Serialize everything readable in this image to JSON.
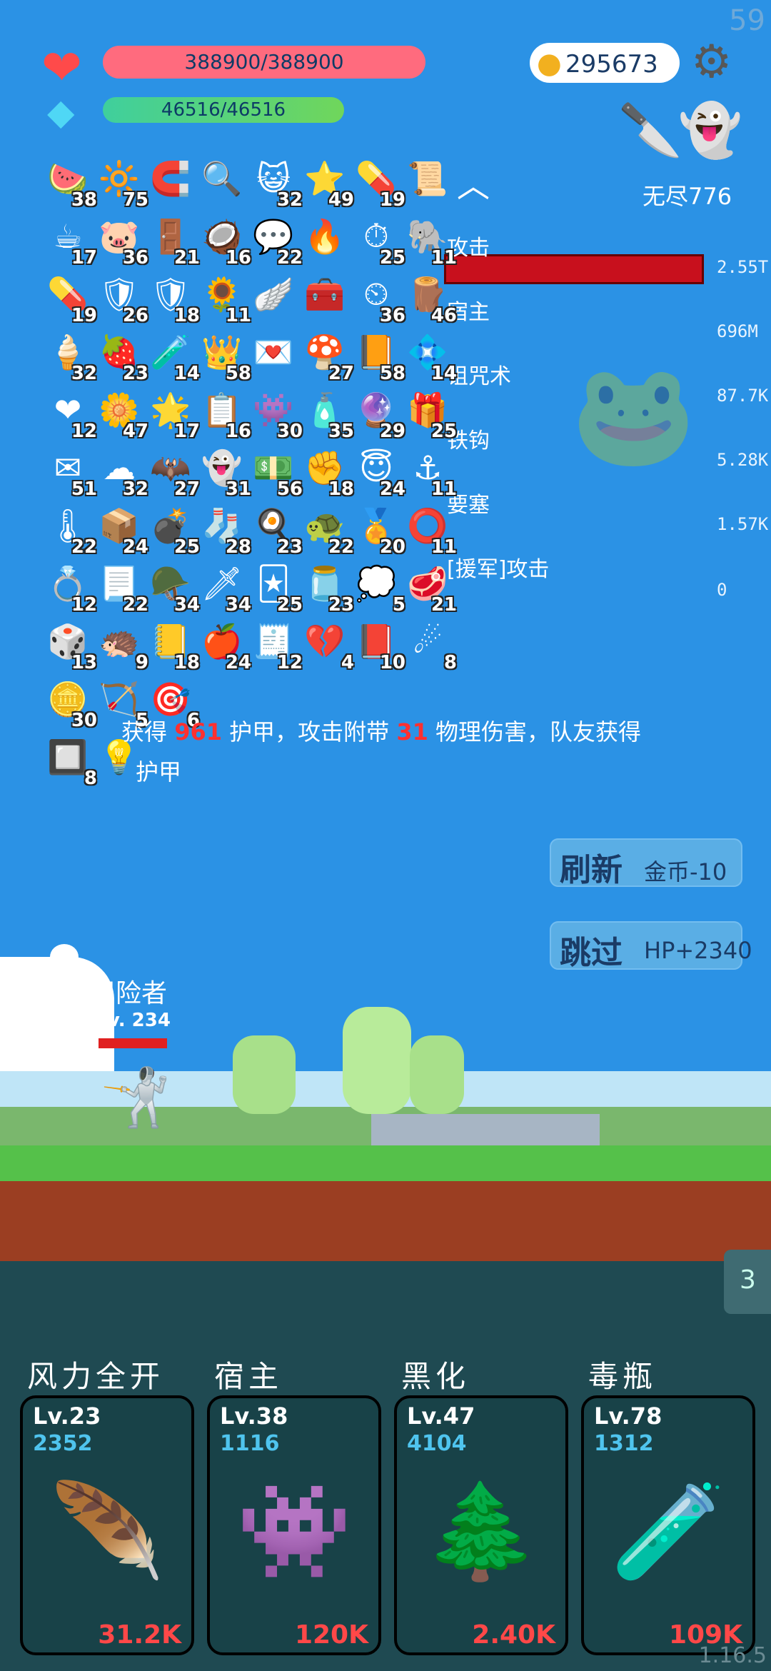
{
  "fps": "59",
  "version": "1.16.5",
  "hp": {
    "text": "388900/388900",
    "fill": 1.0,
    "icon": "heart-icon"
  },
  "mp": {
    "text": "46516/46516",
    "fill": 1.0,
    "icon": "crystal-icon"
  },
  "gold": "295673",
  "mode_label": "无尽776",
  "items": [
    {
      "icon": "🍉",
      "count": "38"
    },
    {
      "icon": "🔆",
      "count": "75"
    },
    {
      "icon": "🧲",
      "count": ""
    },
    {
      "icon": "🔍",
      "count": ""
    },
    {
      "icon": "😺",
      "count": "32"
    },
    {
      "icon": "⭐",
      "count": "49"
    },
    {
      "icon": "💊",
      "count": "19"
    },
    {
      "icon": "📜",
      "count": ""
    },
    {
      "icon": "☕",
      "count": "17"
    },
    {
      "icon": "🐷",
      "count": "36"
    },
    {
      "icon": "🚪",
      "count": "21"
    },
    {
      "icon": "🥥",
      "count": "16"
    },
    {
      "icon": "💬",
      "count": "22"
    },
    {
      "icon": "🔥",
      "count": ""
    },
    {
      "icon": "⏱",
      "count": "25"
    },
    {
      "icon": "🐘",
      "count": "11"
    },
    {
      "icon": "💊",
      "count": "19"
    },
    {
      "icon": "🛡",
      "count": "26"
    },
    {
      "icon": "🛡",
      "count": "18"
    },
    {
      "icon": "🌻",
      "count": "11"
    },
    {
      "icon": "🪽",
      "count": ""
    },
    {
      "icon": "🧰",
      "count": ""
    },
    {
      "icon": "⏲",
      "count": "36"
    },
    {
      "icon": "🪵",
      "count": "46"
    },
    {
      "icon": "🍦",
      "count": "32"
    },
    {
      "icon": "🍓",
      "count": "23"
    },
    {
      "icon": "🧪",
      "count": "14"
    },
    {
      "icon": "👑",
      "count": "58"
    },
    {
      "icon": "💌",
      "count": ""
    },
    {
      "icon": "🍄",
      "count": "27"
    },
    {
      "icon": "📙",
      "count": "58"
    },
    {
      "icon": "💠",
      "count": "14"
    },
    {
      "icon": "❤",
      "count": "12"
    },
    {
      "icon": "🌼",
      "count": "47"
    },
    {
      "icon": "🌟",
      "count": "17"
    },
    {
      "icon": "📋",
      "count": "16"
    },
    {
      "icon": "👾",
      "count": "30"
    },
    {
      "icon": "🧴",
      "count": "35"
    },
    {
      "icon": "🔮",
      "count": "29"
    },
    {
      "icon": "🎁",
      "count": "25"
    },
    {
      "icon": "✉",
      "count": "51"
    },
    {
      "icon": "☁",
      "count": "32"
    },
    {
      "icon": "🦇",
      "count": "27"
    },
    {
      "icon": "👻",
      "count": "31"
    },
    {
      "icon": "💵",
      "count": "56"
    },
    {
      "icon": "✊",
      "count": "18"
    },
    {
      "icon": "😇",
      "count": "24"
    },
    {
      "icon": "⚓",
      "count": "11"
    },
    {
      "icon": "🌡",
      "count": "22"
    },
    {
      "icon": "📦",
      "count": "24"
    },
    {
      "icon": "💣",
      "count": "25"
    },
    {
      "icon": "🧦",
      "count": "28"
    },
    {
      "icon": "🍳",
      "count": "23"
    },
    {
      "icon": "🐢",
      "count": "22"
    },
    {
      "icon": "🏅",
      "count": "20"
    },
    {
      "icon": "⭕",
      "count": "11"
    },
    {
      "icon": "💍",
      "count": "12"
    },
    {
      "icon": "📃",
      "count": "22"
    },
    {
      "icon": "🪖",
      "count": "34"
    },
    {
      "icon": "🗡",
      "count": "34"
    },
    {
      "icon": "🃏",
      "count": "25"
    },
    {
      "icon": "🫙",
      "count": "23"
    },
    {
      "icon": "💭",
      "count": "5"
    },
    {
      "icon": "🥩",
      "count": "21"
    },
    {
      "icon": "🎲",
      "count": "13"
    },
    {
      "icon": "🦔",
      "count": "9"
    },
    {
      "icon": "📒",
      "count": "18"
    },
    {
      "icon": "🍎",
      "count": "24"
    },
    {
      "icon": "🧾",
      "count": "12"
    },
    {
      "icon": "💔",
      "count": "4"
    },
    {
      "icon": "📕",
      "count": "10"
    },
    {
      "icon": "☄",
      "count": "8"
    },
    {
      "icon": "🪙",
      "count": "30"
    },
    {
      "icon": "🏹",
      "count": "5"
    },
    {
      "icon": "🎯",
      "count": "6"
    },
    {
      "icon": "🔲",
      "count": "8"
    },
    {
      "icon": "💡",
      "count": ""
    }
  ],
  "damage": {
    "labels": [
      "攻击",
      "宿主",
      "诅咒术",
      "铁钩",
      "要塞",
      "[援军]攻击"
    ],
    "values": [
      "2.55T",
      "696M",
      "87.7K",
      "5.28K",
      "1.57K",
      "0"
    ]
  },
  "desc": {
    "prefix": "获得",
    "v1": "961",
    "mid": "护甲，攻击附带",
    "v2": "31",
    "suffix": "物理伤害，队友获得",
    "line2": "护甲"
  },
  "buttons": {
    "refresh": {
      "main": "刷新",
      "sub": "金币-10"
    },
    "skip": {
      "main": "跳过",
      "sub": "HP+2340"
    }
  },
  "hero": {
    "name": "冒险者",
    "level": "lv. 234"
  },
  "side_tab": "3",
  "skills": [
    {
      "title": "风力全开",
      "level": "Lv.23",
      "num": "2352",
      "cost": "31.2K",
      "icon": "feather-icon",
      "glyph": "🪶"
    },
    {
      "title": "宿主",
      "level": "Lv.38",
      "num": "1116",
      "cost": "120K",
      "icon": "monster-icon",
      "glyph": "👾"
    },
    {
      "title": "黑化",
      "level": "Lv.47",
      "num": "4104",
      "cost": "2.40K",
      "icon": "dark-tree-icon",
      "glyph": "🌲"
    },
    {
      "title": "毒瓶",
      "level": "Lv.78",
      "num": "1312",
      "cost": "109K",
      "icon": "poison-bottle-icon",
      "glyph": "🧪"
    }
  ]
}
